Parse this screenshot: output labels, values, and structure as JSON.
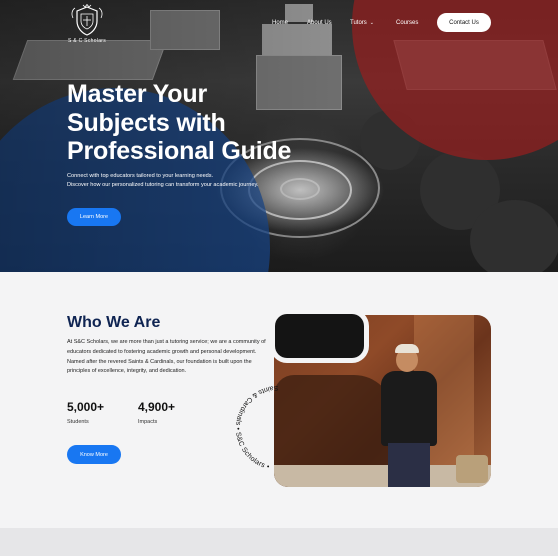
{
  "brand": {
    "name": "S & C Scholars"
  },
  "nav": {
    "items": [
      "Home",
      "About Us",
      "Tutors",
      "Courses"
    ],
    "contact_label": "Contact Us"
  },
  "hero": {
    "title_lines": [
      "Master Your",
      "Subjects with",
      "Professional Guide"
    ],
    "subtitle_lines": [
      "Connect with top educators tailored to your learning needs.",
      "Discover how our personalized tutoring can transform your academic journey."
    ],
    "cta_label": "Learn More",
    "colors": {
      "blue_overlay": "#17468c",
      "red_overlay": "#961e1e"
    }
  },
  "about": {
    "title": "Who We Are",
    "text": "At S&C Scholars, we are more than just a tutoring service; we are a community of educators dedicated to fostering academic growth and personal development. Named after the revered Saints & Cardinals, our foundation is built upon the principles of excellence, integrity, and dedication.",
    "stats": [
      {
        "value": "5,000+",
        "label": "Students"
      },
      {
        "value": "4,900+",
        "label": "Impacts"
      }
    ],
    "cta_label": "Know More",
    "badge_text": "Saints & Cardinals • S&C Scholars •"
  },
  "colors": {
    "accent": "#1877f2",
    "heading": "#0f2452"
  }
}
